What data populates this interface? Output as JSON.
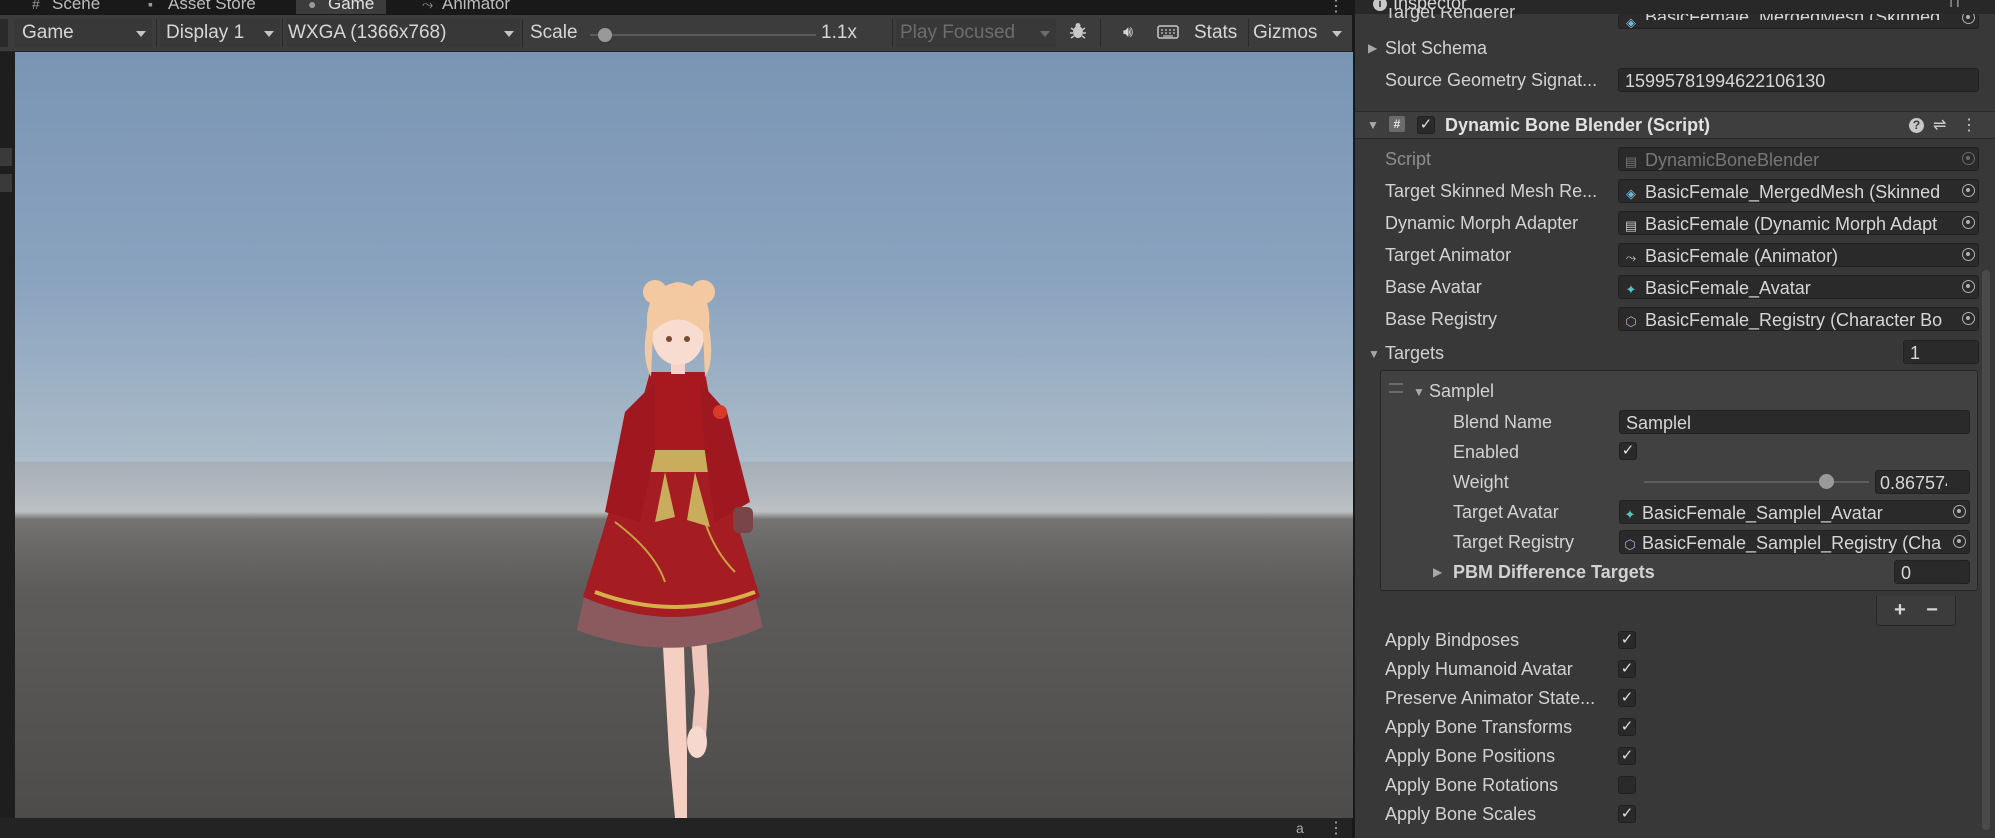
{
  "tabs": [
    {
      "label": "Scene",
      "icon": "hash-icon"
    },
    {
      "label": "Asset Store",
      "icon": "shopping-bag-icon"
    },
    {
      "label": "Game",
      "icon": "gamepad-icon"
    },
    {
      "label": "Animator",
      "icon": "animator-icon"
    }
  ],
  "toolbar": {
    "view_mode": "Game",
    "display": "Display 1",
    "resolution": "WXGA (1366x768)",
    "scale_label": "Scale",
    "scale_value": "1.1x",
    "play_mode": "Play Focused",
    "stats": "Stats",
    "gizmos": "Gizmos"
  },
  "inspector": {
    "title": "Inspector",
    "top_partial_label": "Target Renderer",
    "top_partial_value": "BasicFemale_MergedMesh (Skinned",
    "slot_schema": "Slot Schema",
    "source_geometry_label": "Source Geometry Signat...",
    "source_geometry_value": "15995781994622106130",
    "component": {
      "title": "Dynamic Bone Blender (Script)",
      "enabled": true,
      "fields": [
        {
          "label": "Script",
          "value": "DynamicBoneBlender",
          "icon": "script-file-icon",
          "disabled": true
        },
        {
          "label": "Target Skinned Mesh Re...",
          "value": "BasicFemale_MergedMesh (Skinned",
          "icon": "skinned-mesh-icon",
          "disabled": false
        },
        {
          "label": "Dynamic Morph Adapter",
          "value": "BasicFemale (Dynamic Morph Adapt",
          "icon": "script-file-icon",
          "disabled": false
        },
        {
          "label": "Target Animator",
          "value": "BasicFemale (Animator)",
          "icon": "animator-icon",
          "disabled": false
        },
        {
          "label": "Base Avatar",
          "value": "BasicFemale_Avatar",
          "icon": "avatar-icon",
          "disabled": false
        },
        {
          "label": "Base Registry",
          "value": "BasicFemale_Registry (Character Bo",
          "icon": "registry-icon",
          "disabled": false
        }
      ],
      "targets": {
        "label": "Targets",
        "count": "1",
        "element": {
          "name": "Samplel",
          "blend_name_label": "Blend Name",
          "blend_name_value": "Samplel",
          "enabled_label": "Enabled",
          "enabled": true,
          "weight_label": "Weight",
          "weight_value": "0.8675743",
          "weight_fraction": 0.8675743,
          "target_avatar_label": "Target Avatar",
          "target_avatar_value": "BasicFemale_Samplel_Avatar",
          "target_registry_label": "Target Registry",
          "target_registry_value": "BasicFemale_Samplel_Registry (Cha",
          "pbm_label": "PBM Difference Targets",
          "pbm_count": "0"
        },
        "add_label": "+",
        "remove_label": "−"
      },
      "toggles": [
        {
          "label": "Apply Bindposes",
          "checked": true
        },
        {
          "label": "Apply Humanoid Avatar",
          "checked": true
        },
        {
          "label": "Preserve Animator State...",
          "checked": true
        },
        {
          "label": "Apply Bone Transforms",
          "checked": true
        },
        {
          "label": "Apply Bone Positions",
          "checked": true
        },
        {
          "label": "Apply Bone Rotations",
          "checked": false
        },
        {
          "label": "Apply Bone Scales",
          "checked": true
        }
      ]
    }
  },
  "status": {
    "corner_letter": "a"
  }
}
